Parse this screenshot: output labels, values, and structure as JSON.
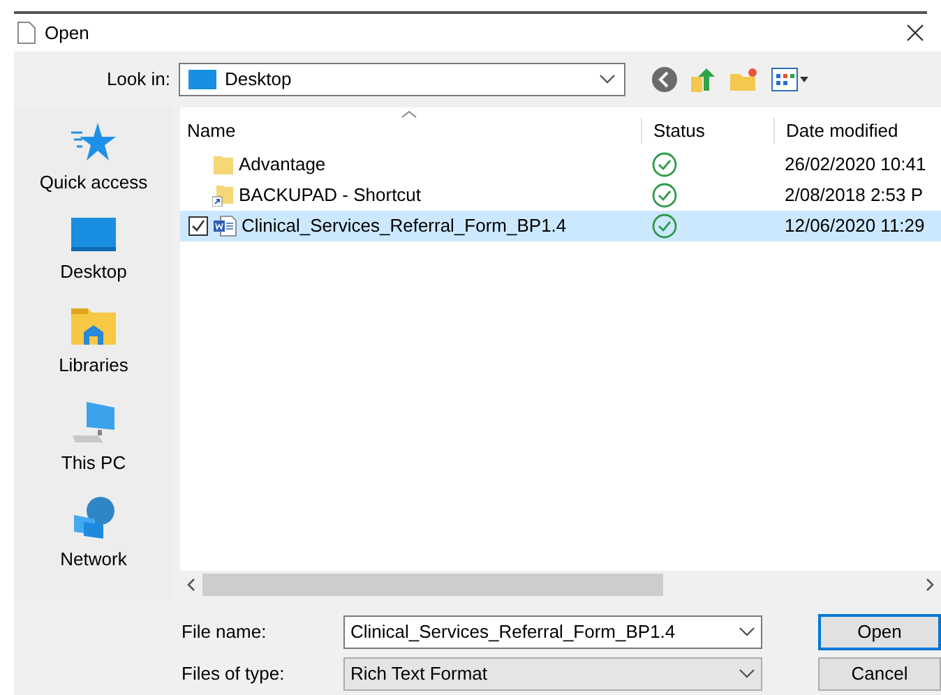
{
  "window": {
    "title": "Open"
  },
  "look_in": {
    "label": "Look in:",
    "value": "Desktop"
  },
  "sidebar": {
    "items": [
      {
        "label": "Quick access",
        "kind": "star"
      },
      {
        "label": "Desktop",
        "kind": "desktop"
      },
      {
        "label": "Libraries",
        "kind": "libraries"
      },
      {
        "label": "This PC",
        "kind": "pc"
      },
      {
        "label": "Network",
        "kind": "network"
      }
    ]
  },
  "table": {
    "columns": [
      "Name",
      "Status",
      "Date modified"
    ],
    "rows": [
      {
        "name": "Advantage",
        "kind": "folder",
        "synced": true,
        "date": "26/02/2020 10:41",
        "selected": false
      },
      {
        "name": "BACKUPAD - Shortcut",
        "kind": "shortcut",
        "synced": true,
        "date": "2/08/2018 2:53 P",
        "selected": false
      },
      {
        "name": "Clinical_Services_Referral_Form_BP1.4",
        "kind": "document",
        "synced": true,
        "date": "12/06/2020 11:29",
        "selected": true
      }
    ]
  },
  "file_name": {
    "label": "File name:",
    "value": "Clinical_Services_Referral_Form_BP1.4"
  },
  "file_type": {
    "label": "Files of type:",
    "value": "Rich Text Format"
  },
  "buttons": [
    "Open",
    "Cancel"
  ]
}
